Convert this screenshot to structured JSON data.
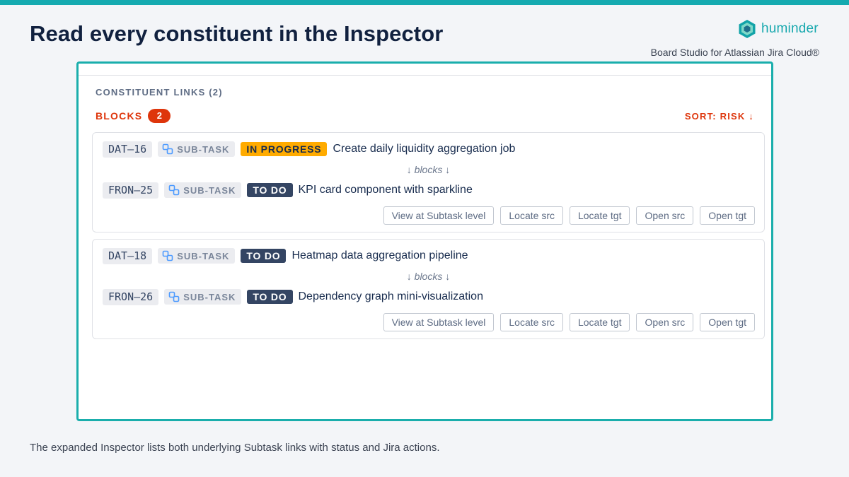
{
  "slide": {
    "title": "Read every constituent in the Inspector",
    "brand_name": "huminder",
    "brand_subtitle": "Board Studio for Atlassian Jira Cloud®",
    "caption": "The expanded Inspector lists both underlying Subtask links with status and Jira actions.",
    "accent_color": "#14aab0"
  },
  "inspector": {
    "section_heading": "CONSTITUENT LINKS (2)",
    "group_label": "BLOCKS",
    "group_count": "2",
    "sort_label": "SORT: RISK ↓",
    "link_verb": "↓ blocks ↓",
    "actions": [
      "View at Subtask level",
      "Locate src",
      "Locate tgt",
      "Open src",
      "Open tgt"
    ],
    "links": [
      {
        "source": {
          "key": "DAT–16",
          "type": "SUB-TASK",
          "type_icon": "subtask-icon",
          "status": "IN PROGRESS",
          "summary": "Create daily liquidity aggregation job"
        },
        "target": {
          "key": "FRON–25",
          "type": "SUB-TASK",
          "type_icon": "subtask-icon",
          "status": "TO DO",
          "summary": "KPI card component with sparkline"
        }
      },
      {
        "source": {
          "key": "DAT–18",
          "type": "SUB-TASK",
          "type_icon": "subtask-icon",
          "status": "TO DO",
          "summary": "Heatmap data aggregation pipeline"
        },
        "target": {
          "key": "FRON–26",
          "type": "SUB-TASK",
          "type_icon": "subtask-icon",
          "status": "TO DO",
          "summary": "Dependency graph mini-visualization"
        }
      }
    ]
  },
  "colors": {
    "blocks_red": "#de350b",
    "in_progress": "#ffab00",
    "to_do": "#344563",
    "frame_teal": "#1aaeac"
  }
}
